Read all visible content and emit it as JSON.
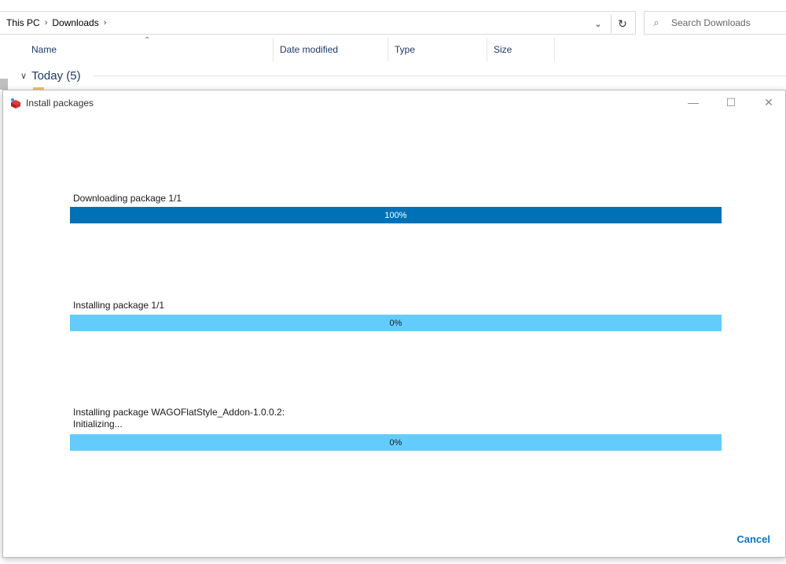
{
  "explorer": {
    "breadcrumb": [
      "This PC",
      "Downloads"
    ],
    "search_placeholder": "Search Downloads",
    "columns": [
      "Name",
      "Date modified",
      "Type",
      "Size"
    ],
    "group": "Today (5)"
  },
  "dialog": {
    "title": "Install packages",
    "icon": "wago-package-icon",
    "controls": {
      "minimize": "—",
      "maximize": "☐",
      "close": "✕"
    },
    "progress": [
      {
        "label": "Downloading package 1/1",
        "percent_text": "100%",
        "fraction": 1.0
      },
      {
        "label": "Installing package 1/1",
        "percent_text": "0%",
        "fraction": 0.0
      },
      {
        "label": "Installing package WAGOFlatStyle_Addon-1.0.0.2:\nInitializing...",
        "percent_text": "0%",
        "fraction": 0.0
      }
    ],
    "cancel_label": "Cancel",
    "colors": {
      "bar_fill": "#0171b5",
      "bar_track": "#63ccfc",
      "link": "#0d74c2"
    }
  }
}
